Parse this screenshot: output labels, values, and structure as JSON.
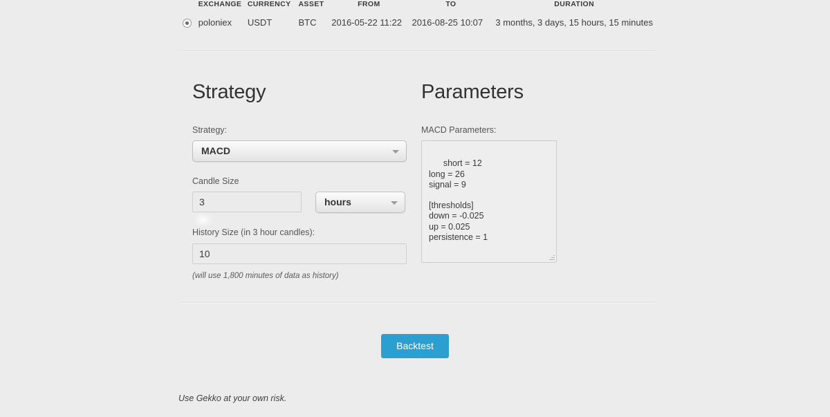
{
  "market_table": {
    "columns": [
      "",
      "EXCHANGE",
      "CURRENCY",
      "ASSET",
      "FROM",
      "TO",
      "DURATION"
    ],
    "rows": [
      {
        "selected": true,
        "exchange": "poloniex",
        "currency": "USDT",
        "asset": "BTC",
        "from": "2016-05-22 11:22",
        "to": "2016-08-25 10:07",
        "duration": "3 months, 3 days, 15 hours, 15 minutes"
      }
    ]
  },
  "strategy": {
    "title": "Strategy",
    "strategy_label": "Strategy:",
    "strategy_value": "MACD",
    "candle_size_label": "Candle Size",
    "candle_size_value": "3",
    "candle_unit_value": "hours",
    "history_label": "History Size (in 3 hour candles):",
    "history_value": "10",
    "history_hint": "(will use 1,800 minutes of data as history)"
  },
  "parameters": {
    "title": "Parameters",
    "label": "MACD Parameters:",
    "content": "short = 12\nlong = 26\nsignal = 9\n\n[thresholds]\ndown = -0.025\nup = 0.025\npersistence = 1"
  },
  "actions": {
    "backtest_label": "Backtest"
  },
  "footer": {
    "disclaimer": "Use Gekko at your own risk."
  },
  "colors": {
    "background": "#ececec",
    "accent": "#2b9fd0",
    "text": "#333333"
  }
}
